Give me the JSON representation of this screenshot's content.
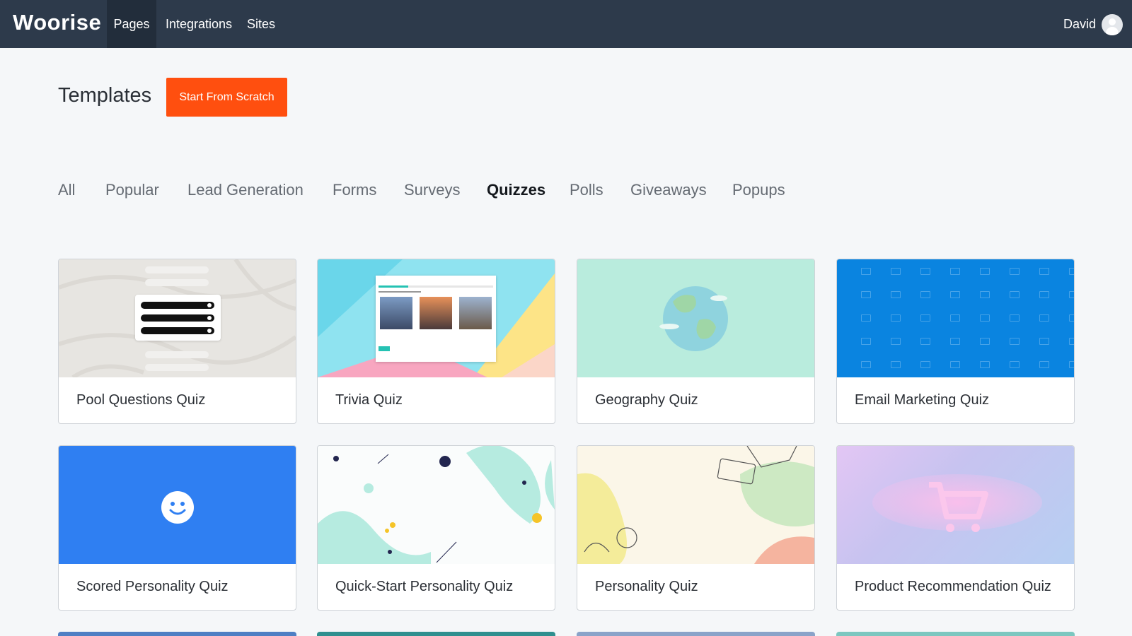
{
  "nav": {
    "logo": "Woorise",
    "links": [
      {
        "label": "Pages",
        "active": true
      },
      {
        "label": "Integrations",
        "active": false
      },
      {
        "label": "Sites",
        "active": false
      }
    ],
    "user": {
      "name": "David",
      "icon": "user-avatar-icon"
    }
  },
  "header": {
    "title": "Templates",
    "cta_label": "Start From Scratch"
  },
  "tabs": [
    {
      "label": "All",
      "active": false
    },
    {
      "label": "Popular",
      "active": false
    },
    {
      "label": "Lead Generation",
      "active": false
    },
    {
      "label": "Forms",
      "active": false
    },
    {
      "label": "Surveys",
      "active": false
    },
    {
      "label": "Quizzes",
      "active": true
    },
    {
      "label": "Polls",
      "active": false
    },
    {
      "label": "Giveaways",
      "active": false
    },
    {
      "label": "Popups",
      "active": false
    }
  ],
  "templates": [
    {
      "title": "Pool Questions Quiz",
      "thumb": "pool-questions-thumbnail"
    },
    {
      "title": "Trivia Quiz",
      "thumb": "trivia-thumbnail"
    },
    {
      "title": "Geography Quiz",
      "thumb": "globe-thumbnail"
    },
    {
      "title": "Email Marketing Quiz",
      "thumb": "envelope-pattern-thumbnail"
    },
    {
      "title": "Scored Personality Quiz",
      "thumb": "smiley-thumbnail"
    },
    {
      "title": "Quick-Start Personality Quiz",
      "thumb": "confetti-thumbnail"
    },
    {
      "title": "Personality Quiz",
      "thumb": "travel-doodle-thumbnail"
    },
    {
      "title": "Product Recommendation Quiz",
      "thumb": "shopping-cart-thumbnail"
    }
  ],
  "colors": {
    "topbar": "#2d3a4b",
    "accent": "#ff4f0f",
    "page_bg": "#f5f7f9"
  }
}
